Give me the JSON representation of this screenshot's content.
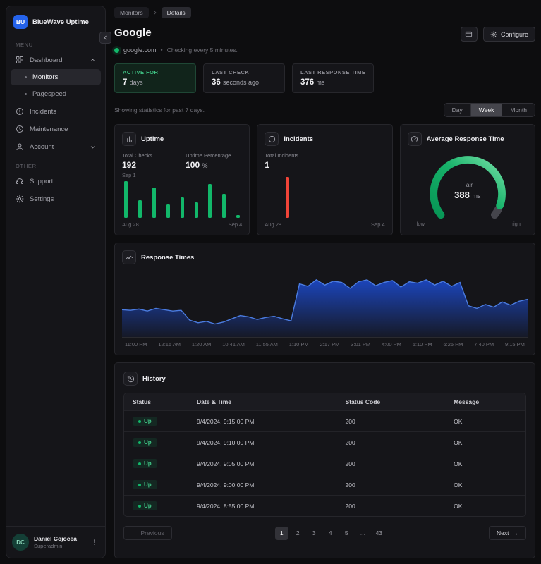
{
  "sidebar": {
    "logo_text": "BU",
    "app_name": "BlueWave Uptime",
    "menu_label": "MENU",
    "other_label": "OTHER",
    "dashboard_label": "Dashboard",
    "monitors_label": "Monitors",
    "pagespeed_label": "Pagespeed",
    "incidents_label": "Incidents",
    "maintenance_label": "Maintenance",
    "account_label": "Account",
    "support_label": "Support",
    "settings_label": "Settings",
    "user_initials": "DC",
    "user_name": "Daniel Cojocea",
    "user_role": "Superadmin"
  },
  "header": {
    "breadcrumb_monitors": "Monitors",
    "breadcrumb_details": "Details",
    "title": "Google",
    "url": "google.com",
    "separator": "•",
    "checking_note": "Checking every 5 minutes.",
    "configure_label": "Configure"
  },
  "stats": {
    "active_label": "ACTIVE FOR",
    "active_value": "7",
    "active_unit": "days",
    "last_check_label": "LAST CHECK",
    "last_check_value": "36",
    "last_check_unit": "seconds ago",
    "last_response_label": "LAST RESPONSE TIME",
    "last_response_value": "376",
    "last_response_unit": "ms"
  },
  "filters": {
    "note": "Showing statistics for past 7 days.",
    "options": [
      "Day",
      "Week",
      "Month"
    ],
    "active": "Week"
  },
  "uptime_card": {
    "title": "Uptime",
    "total_checks_label": "Total Checks",
    "total_checks_value": "192",
    "uptime_label": "Uptime Percentage",
    "uptime_value": "100",
    "uptime_unit": "%",
    "date_label": "Sep 1",
    "range_start": "Aug 28",
    "range_end": "Sep 4"
  },
  "incidents_card": {
    "title": "Incidents",
    "total_label": "Total Incidents",
    "total_value": "1",
    "range_start": "Aug 28",
    "range_end": "Sep 4"
  },
  "gauge_card": {
    "title": "Average Response Time",
    "grade": "Fair",
    "value": "388",
    "unit": "ms",
    "low_label": "low",
    "high_label": "high"
  },
  "response_card": {
    "title": "Response Times"
  },
  "history": {
    "title": "History",
    "columns": [
      "Status",
      "Date & Time",
      "Status Code",
      "Message"
    ],
    "rows": [
      {
        "status": "Up",
        "datetime": "9/4/2024, 9:15:00 PM",
        "code": "200",
        "message": "OK"
      },
      {
        "status": "Up",
        "datetime": "9/4/2024, 9:10:00 PM",
        "code": "200",
        "message": "OK"
      },
      {
        "status": "Up",
        "datetime": "9/4/2024, 9:05:00 PM",
        "code": "200",
        "message": "OK"
      },
      {
        "status": "Up",
        "datetime": "9/4/2024, 9:00:00 PM",
        "code": "200",
        "message": "OK"
      },
      {
        "status": "Up",
        "datetime": "9/4/2024, 8:55:00 PM",
        "code": "200",
        "message": "OK"
      }
    ]
  },
  "pagination": {
    "previous_label": "Previous",
    "next_label": "Next",
    "prev_icon": "←",
    "next_icon": "→",
    "pages": [
      "1",
      "2",
      "3",
      "4",
      "5",
      "...",
      "43"
    ],
    "active_page": "1"
  },
  "chart_data": [
    {
      "type": "bar",
      "name": "uptime-bars",
      "title": "Uptime checks per day",
      "x_range": [
        "Aug 28",
        "Sep 4"
      ],
      "values_pct": [
        100,
        48,
        82,
        36,
        55,
        42,
        92,
        65,
        8
      ],
      "color": "#12b76a"
    },
    {
      "type": "bar",
      "name": "incidents-bars",
      "title": "Incidents per day",
      "x_range": [
        "Aug 28",
        "Sep 4"
      ],
      "values_pct": [
        0,
        90,
        0,
        0,
        0,
        0,
        0,
        0
      ],
      "color": "#f04438"
    },
    {
      "type": "gauge",
      "name": "avg-response-gauge",
      "title": "Average Response Time",
      "grade": "Fair",
      "value_ms": 388,
      "percent": 0.93,
      "track_color": "#45454c"
    },
    {
      "type": "area",
      "name": "response-times",
      "title": "Response Times",
      "x_labels": [
        "11:00 PM",
        "12:15 AM",
        "1:20 AM",
        "10:41 AM",
        "11:55 AM",
        "1:10 PM",
        "2:17 PM",
        "3:01 PM",
        "4:00 PM",
        "5:10 PM",
        "6:25 PM",
        "7:40 PM",
        "9:15 PM"
      ],
      "values_pct": [
        42,
        41,
        43,
        40,
        44,
        42,
        40,
        41,
        26,
        22,
        24,
        20,
        23,
        28,
        33,
        31,
        27,
        30,
        32,
        28,
        25,
        82,
        78,
        88,
        80,
        86,
        84,
        75,
        85,
        88,
        79,
        84,
        87,
        77,
        85,
        83,
        88,
        80,
        86,
        78,
        84,
        48,
        44,
        50,
        46,
        54,
        49,
        55,
        58
      ],
      "line_color": "#4b7ce0",
      "fill_color": "#1d4ed8"
    }
  ]
}
